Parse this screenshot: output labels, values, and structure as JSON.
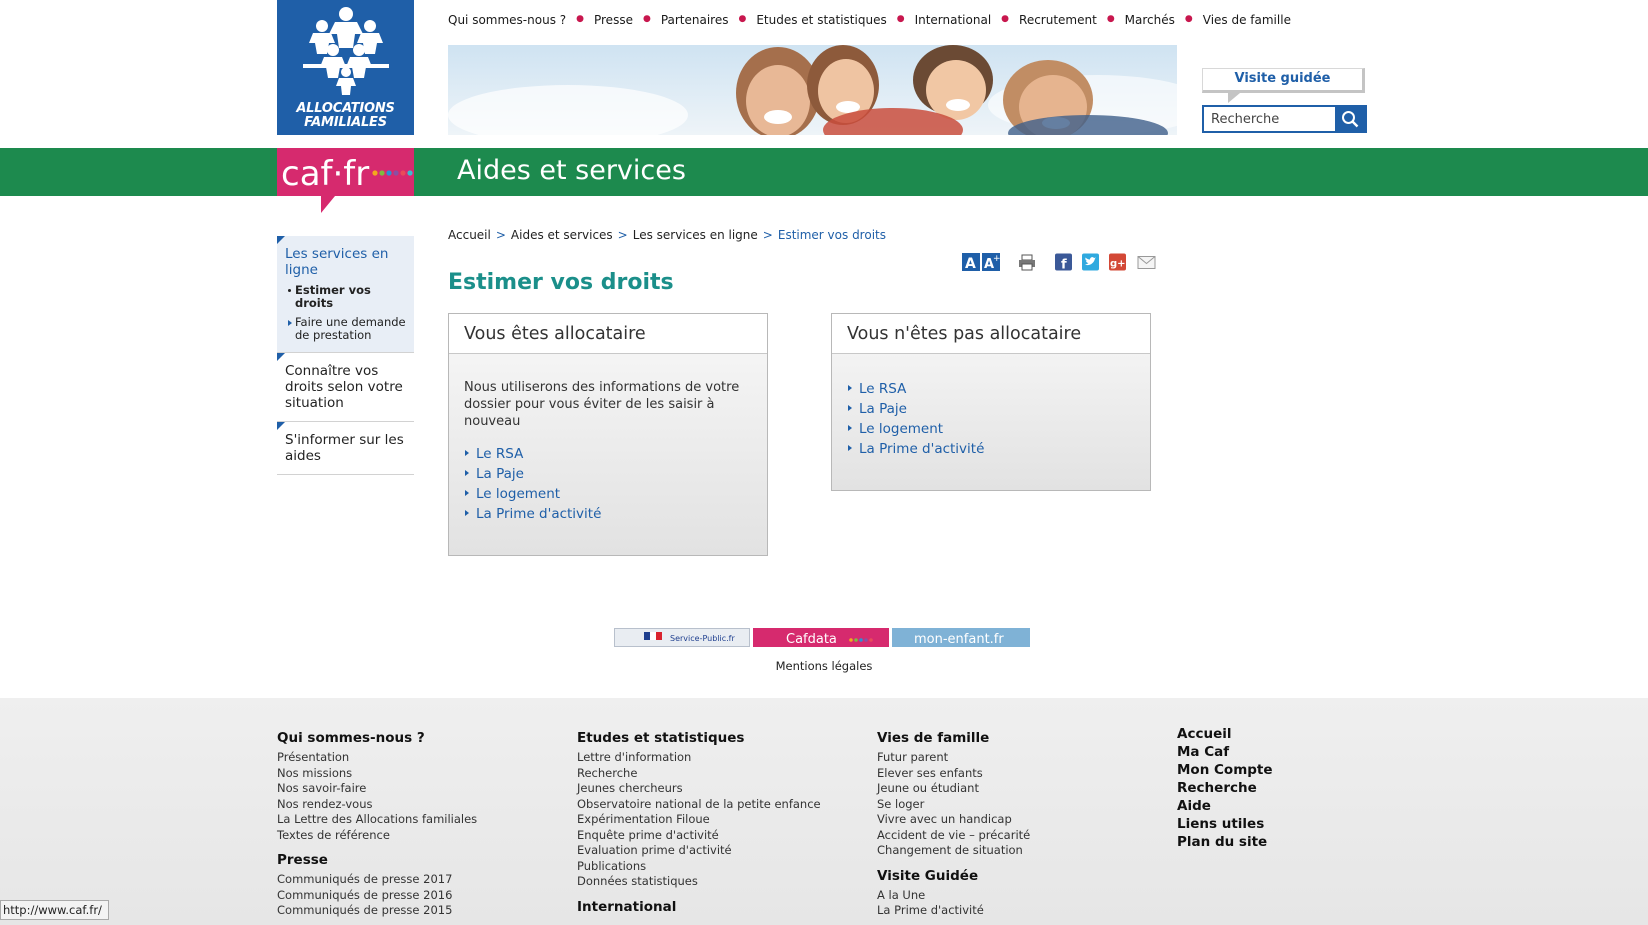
{
  "logo": {
    "line1": "ALLOCATIONS",
    "line2": "FAMILIALES"
  },
  "topnav": [
    "Qui sommes-nous ?",
    "Presse",
    "Partenaires",
    "Etudes et statistiques",
    "International",
    "Recrutement",
    "Marchés",
    "Vies de famille"
  ],
  "header": {
    "visite_label": "Visite guidée",
    "search_placeholder": "Recherche"
  },
  "section_title": "Aides et services",
  "caf_logo_text": "caf·fr",
  "leftnav": {
    "block1": {
      "title": "Les services en ligne",
      "items": [
        "Estimer vos droits",
        "Faire une demande de prestation"
      ]
    },
    "block2": {
      "title": "Connaître vos droits selon votre situation"
    },
    "block3": {
      "title": "S'informer sur les aides"
    }
  },
  "breadcrumb": [
    "Accueil",
    "Aides et services",
    "Les services en ligne",
    "Estimer vos droits"
  ],
  "page_title": "Estimer vos droits",
  "cards": [
    {
      "title": "Vous êtes allocataire",
      "text": "Nous utiliserons des informations de votre dossier pour vous éviter de les saisir à nouveau",
      "links": [
        "Le RSA",
        "La Paje",
        "Le logement",
        "La Prime d'activité"
      ]
    },
    {
      "title": "Vous n'êtes pas allocataire",
      "links": [
        "Le RSA",
        "La Paje",
        "Le logement",
        "La Prime d'activité"
      ]
    }
  ],
  "partners": {
    "service_public": "Service-Public.fr",
    "cafdata": "Cafdata",
    "mon_enfant": "mon-enfant.fr"
  },
  "mentions": "Mentions légales",
  "footer": {
    "col1": {
      "title": "Qui sommes-nous ?",
      "links": [
        "Présentation",
        "Nos missions",
        "Nos savoir-faire",
        "Nos rendez-vous",
        "La Lettre des Allocations familiales",
        "Textes de référence"
      ],
      "title2": "Presse",
      "links2": [
        "Communiqués de presse 2017",
        "Communiqués de presse 2016",
        "Communiqués de presse 2015"
      ]
    },
    "col2": {
      "title": "Etudes et statistiques",
      "links": [
        "Lettre d'information",
        "Recherche",
        "Jeunes chercheurs",
        "Observatoire national de la petite enfance",
        "Expérimentation Filoue",
        "Enquête prime d'activité",
        "Evaluation prime d'activité",
        "Publications",
        "Données statistiques"
      ],
      "title2": "International"
    },
    "col3": {
      "title": "Vies de famille",
      "links": [
        "Futur parent",
        "Elever ses enfants",
        "Jeune ou étudiant",
        "Se loger",
        "Vivre avec un handicap",
        "Accident de vie – précarité",
        "Changement de situation"
      ],
      "title2": "Visite Guidée",
      "links2": [
        "A la Une",
        "La Prime d'activité"
      ]
    },
    "col4": [
      "Accueil",
      "Ma Caf",
      "Mon Compte",
      "Recherche",
      "Aide",
      "Liens utiles",
      "Plan du site"
    ]
  },
  "status_url": "http://www.caf.fr/",
  "colors": {
    "brand_blue": "#1f5fa8",
    "green_band": "#1d8a4e",
    "title_teal": "#1b8f8a",
    "caf_pink": "#d62a6e"
  }
}
